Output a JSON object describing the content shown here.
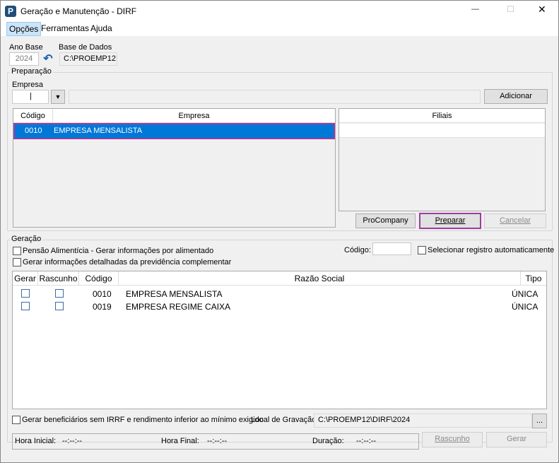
{
  "window": {
    "title": "Geração e Manutenção - DIRF",
    "minimize": "—",
    "maximize": "☐",
    "close": "✕"
  },
  "menu": [
    "Opções",
    "Ferramentas",
    "Ajuda"
  ],
  "top": {
    "ano_base_label": "Ano Base",
    "ano_base": "2024",
    "base_label": "Base de Dados",
    "base": "C:\\PROEMP12"
  },
  "preparacao": {
    "title": "Preparação",
    "empresa_label": "Empresa",
    "empresa_value": "|",
    "add": "Adicionar",
    "grid_headers": [
      "Código",
      "Empresa"
    ],
    "rows": [
      {
        "codigo": "0010",
        "empresa": "EMPRESA MENSALISTA"
      }
    ],
    "filiais_header": "Filiais",
    "procompany": "ProCompany",
    "preparar": "Preparar",
    "cancelar": "Cancelar"
  },
  "geracao": {
    "title": "Geração",
    "pensao": "Pensão Alimentícia - Gerar informações por alimentado",
    "prev": "Gerar informações detalhadas da previdência complementar",
    "codigo_label": "Código:",
    "auto": "Selecionar registro automaticamente",
    "headers": [
      "Gerar",
      "Rascunho",
      "Código",
      "Razão Social",
      "Tipo"
    ],
    "rows": [
      {
        "codigo": "0010",
        "razao": "EMPRESA MENSALISTA",
        "tipo": "ÚNICA"
      },
      {
        "codigo": "0019",
        "razao": "EMPRESA REGIME CAIXA",
        "tipo": "ÚNICA"
      }
    ],
    "benef": "Gerar beneficiários sem IRRF e rendimento inferior ao mínimo exigido",
    "local_label": "Local de Gravação",
    "local": "C:\\PROEMP12\\DIRF\\2024",
    "browse": "...",
    "hora_inicial_label": "Hora Inicial:",
    "hora_inicial": "--:--:--",
    "hora_final_label": "Hora Final:",
    "hora_final": "--:--:--",
    "duracao_label": "Duração:",
    "duracao": "--:--:--",
    "rascunho": "Rascunho",
    "gerar": "Gerar"
  }
}
